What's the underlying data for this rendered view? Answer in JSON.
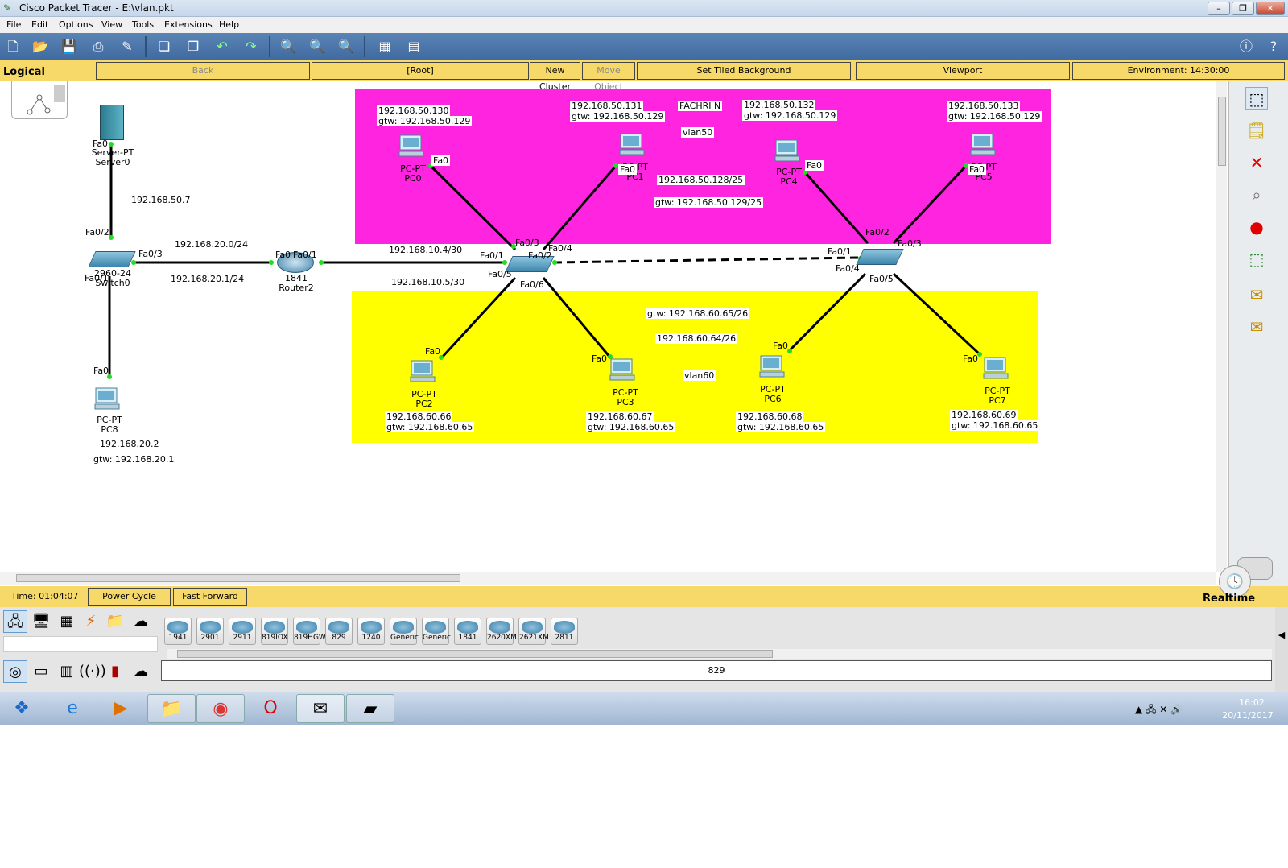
{
  "window": {
    "title": "Cisco Packet Tracer - E:\\vlan.pkt"
  },
  "menu": [
    "File",
    "Edit",
    "Options",
    "View",
    "Tools",
    "Extensions",
    "Help"
  ],
  "nav": {
    "mode": "Logical",
    "back": "Back",
    "root": "[Root]",
    "new_cluster": "New Cluster",
    "move_object": "Move Object",
    "tiled_bg": "Set Tiled Background",
    "viewport": "Viewport",
    "environment": "Environment: 14:30:00"
  },
  "network": {
    "labels": {
      "server_ip": "192.168.50.7",
      "net_20": "192.168.20.0/24",
      "gw_20": "192.168.20.1/24",
      "net_10_4": "192.168.10.4/30",
      "net_10_5": "192.168.10.5/30",
      "vlan50": "vlan50",
      "vlan60": "vlan60",
      "author": "FACHRI N",
      "net50": "192.168.50.128/25",
      "gw50": "gtw: 192.168.50.129/25",
      "net60": "192.168.60.64/26",
      "gw60": "gtw: 192.168.60.65/26",
      "pc8_ip": "192.168.20.2",
      "pc8_gw": "gtw: 192.168.20.1"
    },
    "devices": {
      "server0": {
        "type": "Server-PT",
        "name": "Server0"
      },
      "switch0": {
        "type": "2960-24",
        "name": "Switch0"
      },
      "router2": {
        "type": "1841",
        "name": "Router2"
      },
      "pc8": {
        "type": "PC-PT",
        "name": "PC8"
      },
      "pc0": {
        "type": "PC-PT",
        "name": "PC0",
        "ip": "192.168.50.130",
        "gw": "gtw: 192.168.50.129"
      },
      "pc1": {
        "type": "PC-PT",
        "name": "PC1",
        "ip": "192.168.50.131",
        "gw": "gtw: 192.168.50.129"
      },
      "pc4": {
        "type": "PC-PT",
        "name": "PC4",
        "ip": "192.168.50.132",
        "gw": "gtw: 192.168.50.129"
      },
      "pc5": {
        "type": "PC-PT",
        "name": "PC5",
        "ip": "192.168.50.133",
        "gw": "gtw: 192.168.50.129"
      },
      "pc2": {
        "type": "PC-PT",
        "name": "PC2",
        "ip": "192.168.60.66",
        "gw": "gtw: 192.168.60.65"
      },
      "pc3": {
        "type": "PC-PT",
        "name": "PC3",
        "ip": "192.168.60.67",
        "gw": "gtw: 192.168.60.65"
      },
      "pc6": {
        "type": "PC-PT",
        "name": "PC6",
        "ip": "192.168.60.68",
        "gw": "gtw: 192.168.60.65"
      },
      "pc7": {
        "type": "PC-PT",
        "name": "PC7",
        "ip": "192.168.60.69",
        "gw": "gtw: 192.168.60.65"
      }
    },
    "ports": {
      "fa0": "Fa0",
      "fa01": "Fa0/1",
      "fa02": "Fa0/2",
      "fa03": "Fa0/3",
      "fa04": "Fa0/4",
      "fa05": "Fa0/5",
      "fa06": "Fa0/6",
      "rfa0": "Fa0",
      "rfa01": "Fa0/1"
    }
  },
  "status": {
    "time": "Time: 01:04:07",
    "power_cycle": "Power Cycle Devices",
    "fast_forward": "Fast Forward Time",
    "mode": "Realtime"
  },
  "device_models": [
    "1941",
    "2901",
    "2911",
    "819IOX",
    "819HGW",
    "829",
    "1240",
    "Generic",
    "Generic",
    "1841",
    "2620XM",
    "2621XM",
    "2811"
  ],
  "selected_model": "829",
  "clock": {
    "time": "16:02",
    "date": "20/11/2017"
  },
  "colors": {
    "vlan50": "#ff24e0",
    "vlan60": "#ffff00",
    "link": "#000000",
    "port_up": "#22dd22",
    "bar": "#f6d968"
  }
}
